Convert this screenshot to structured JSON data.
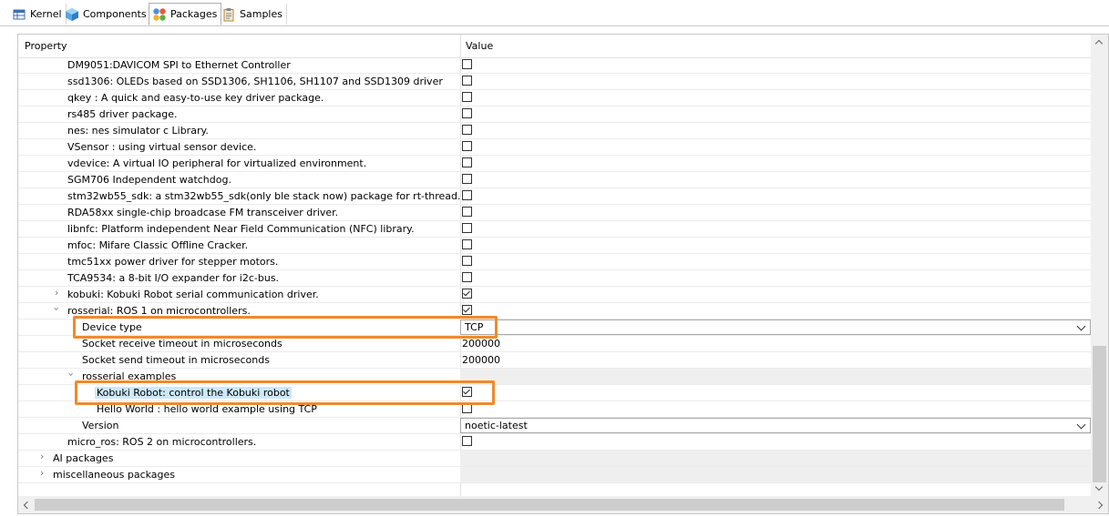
{
  "tabs": [
    {
      "label": "Kernel",
      "icon": "table-icon"
    },
    {
      "label": "Components",
      "icon": "cube-icon"
    },
    {
      "label": "Packages",
      "icon": "packages-icon",
      "active": true
    },
    {
      "label": "Samples",
      "icon": "clipboard-icon"
    }
  ],
  "table": {
    "header_property": "Property",
    "header_value": "Value"
  },
  "rows": [
    {
      "label": "DM9051:DAVICOM SPI to Ethernet Controller",
      "checked": false
    },
    {
      "label": "ssd1306: OLEDs based on SSD1306, SH1106, SH1107 and SSD1309 driver",
      "checked": false
    },
    {
      "label": "qkey : A quick and easy-to-use key driver package.",
      "checked": false
    },
    {
      "label": "rs485 driver package.",
      "checked": false
    },
    {
      "label": "nes: nes simulator c Library.",
      "checked": false
    },
    {
      "label": "VSensor : using virtual sensor device.",
      "checked": false
    },
    {
      "label": "vdevice: A virtual IO peripheral for virtualized environment.",
      "checked": false
    },
    {
      "label": "SGM706 Independent watchdog.",
      "checked": false
    },
    {
      "label": "stm32wb55_sdk: a stm32wb55_sdk(only ble stack now) package for rt-thread.",
      "checked": false
    },
    {
      "label": "RDA58xx single-chip broadcase FM transceiver driver.",
      "checked": false
    },
    {
      "label": "libnfc: Platform independent Near Field Communication (NFC) library.",
      "checked": false
    },
    {
      "label": "mfoc: Mifare Classic Offline Cracker.",
      "checked": false
    },
    {
      "label": "tmc51xx power driver for stepper motors.",
      "checked": false
    },
    {
      "label": "TCA9534: a 8-bit I/O expander for i2c-bus.",
      "checked": false
    },
    {
      "label": "kobuki: Kobuki Robot serial communication driver.",
      "checked": true
    },
    {
      "label": "rosserial: ROS 1 on microcontrollers.",
      "checked": true
    },
    {
      "label": "Device type",
      "value": "TCP"
    },
    {
      "label": "Socket receive timeout in microseconds",
      "value": "200000"
    },
    {
      "label": "Socket send timeout in microseconds",
      "value": "200000"
    },
    {
      "label": "rosserial examples"
    },
    {
      "label": "Kobuki Robot: control the Kobuki robot",
      "checked": true
    },
    {
      "label": "Hello World : hello world example using TCP",
      "checked": false
    },
    {
      "label": "Version",
      "value": "noetic-latest"
    },
    {
      "label": "micro_ros: ROS 2 on microcontrollers.",
      "checked": false
    },
    {
      "label": "AI packages"
    },
    {
      "label": "miscellaneous packages"
    }
  ],
  "colors": {
    "highlight": "#f08a2a",
    "selection": "#cde8ff"
  }
}
